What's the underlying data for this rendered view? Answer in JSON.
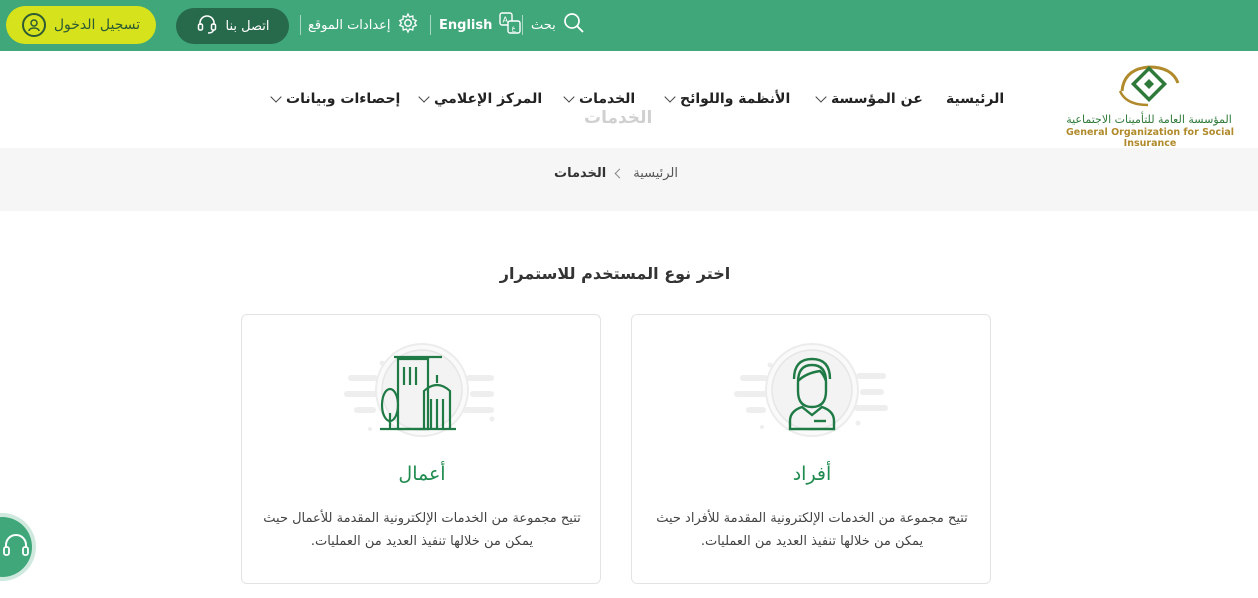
{
  "topbar": {
    "login_label": "تسجيل الدخول",
    "contact_label": "اتصل بنا",
    "settings_label": "إعدادات الموقع",
    "language_label": "English",
    "search_label": "بحث",
    "icons": [
      "user-icon",
      "headset-icon",
      "gear-icon",
      "translate-icon",
      "search-icon"
    ]
  },
  "header": {
    "logo_ar": "المؤسسة العامة للتأمينات الاجتماعية",
    "logo_en": "General Organization for Social Insurance",
    "nav": [
      "الرئيسية",
      "عن المؤسسة",
      "الأنظمة واللوائح",
      "الخدمات",
      "المركز الإعلامي",
      "إحصاءات وبيانات"
    ],
    "ghost_label": "الخدمات"
  },
  "breadcrumb": {
    "home": "الرئيسية",
    "current": "الخدمات"
  },
  "main": {
    "heading": "اختر نوع المستخدم للاستمرار",
    "cards": [
      {
        "title": "أفراد",
        "desc": "تتيح مجموعة من الخدمات الإلكترونية المقدمة للأفراد حيث يمكن من خلالها تنفيذ العديد من العمليات."
      },
      {
        "title": "أعمال",
        "desc": "تتيح مجموعة من الخدمات الإلكترونية المقدمة للأعمال حيث يمكن من خلالها تنفيذ العديد من العمليات."
      }
    ]
  },
  "colors": {
    "primary_green": "#3fa77a",
    "accent_yellow": "#d6e21c",
    "dark_green": "#27694b",
    "title_green": "#1f8b4f"
  }
}
